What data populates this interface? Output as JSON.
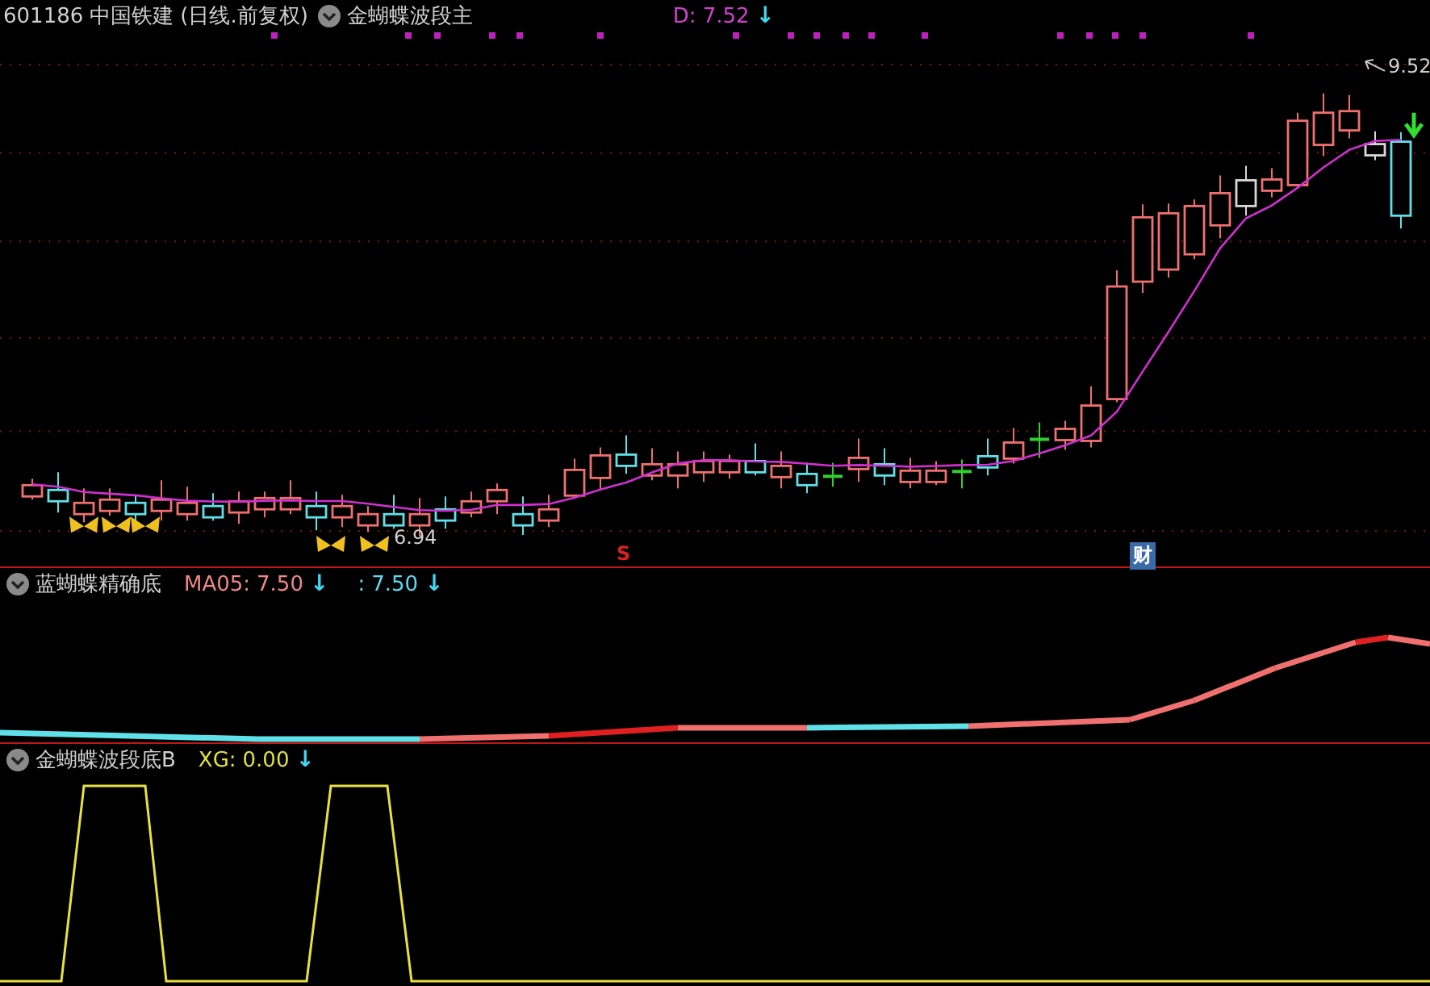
{
  "main_panel": {
    "code": "601186",
    "name": "中国铁建",
    "period": "(日线.前复权)",
    "indicator": "金蝴蝶波段主",
    "reading": {
      "label": "D:",
      "value": "7.52",
      "arrow": "↓"
    },
    "high_label": "9.52",
    "low_label": "6.94",
    "markers": [
      {
        "text": "S",
        "kind": "sell"
      },
      {
        "text": "财",
        "kind": "finance"
      }
    ]
  },
  "panel_2": {
    "indicator": "蓝蝴蝶精确底",
    "readings": [
      {
        "label": "MA05:",
        "value": "7.50",
        "arrow": "↓"
      },
      {
        "label": ":",
        "value": "7.50",
        "arrow": "↓"
      }
    ]
  },
  "panel_3": {
    "indicator": "金蝴蝶波段底B",
    "readings": [
      {
        "label": "XG:",
        "value": "0.00",
        "arrow": "↓"
      }
    ]
  }
}
